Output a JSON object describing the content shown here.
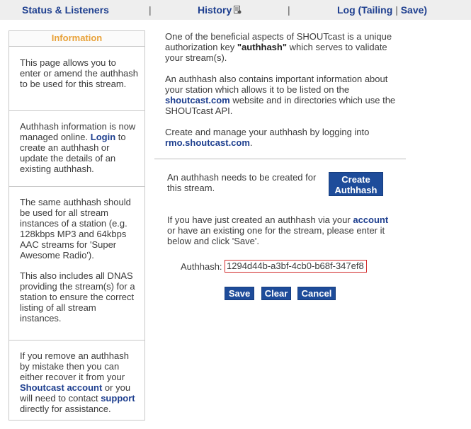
{
  "nav": {
    "status_listeners": "Status & Listeners",
    "history": "History",
    "log": "Log",
    "tailing": "Tailing",
    "save": "Save",
    "sep": "|",
    "paren_open": "(",
    "paren_close": ")",
    "pipe": "|"
  },
  "info_panel": {
    "title": "Information",
    "block1": "This page allows you to enter or amend the authhash to be used for this stream.",
    "block2_pre": "Authhash information is now managed online.",
    "block2_link": "Login",
    "block2_post": "to create an authhash or update the details of an existing authhash.",
    "block3_p1": "The same authhash should be used for all stream instances of a station (e.g. 128kbps MP3 and 64kbps AAC streams for 'Super Awesome Radio').",
    "block3_p2": "This also includes all DNAS providing the stream(s) for a station to ensure the correct listing of all stream instances.",
    "block4_pre": "If you remove an authhash by mistake then you can either recover it from your",
    "block4_link1": "Shoutcast account",
    "block4_mid": "or you will need to contact",
    "block4_link2": "support",
    "block4_post": "directly for assistance."
  },
  "main": {
    "intro_pre": "One of the beneficial aspects of SHOUTcast is a unique authorization key",
    "intro_key": "\"authhash\"",
    "intro_post": "which serves to validate your stream(s).",
    "para2_pre": "An authhash also contains important information about your station which allows it to be listed on the",
    "para2_link": "shoutcast.com",
    "para2_post": "website and in directories which use the SHOUTcast API.",
    "para3_pre": "Create and manage your authhash by logging into",
    "para3_link": "rmo.shoutcast.com",
    "para3_post": ".",
    "create_msg": "An authhash needs to be created for this stream.",
    "create_button": "Create Authhash",
    "existing_pre": "If you have just created an authhash via your",
    "existing_link": "account",
    "existing_post": "or have an existing one for the stream, please enter it below and click 'Save'.",
    "authhash_label": "Authhash:",
    "authhash_value": "1294d44b-a3bf-4cb0-b68f-347ef8",
    "save_button": "Save",
    "clear_button": "Clear",
    "cancel_button": "Cancel"
  },
  "colors": {
    "link": "#1e3f8f",
    "panel_title": "#e8a23a",
    "button": "#1e4c9a",
    "input_border": "#d22b2b",
    "topbar_bg": "#eeeeee"
  },
  "icons": {
    "history": "history-icon"
  }
}
